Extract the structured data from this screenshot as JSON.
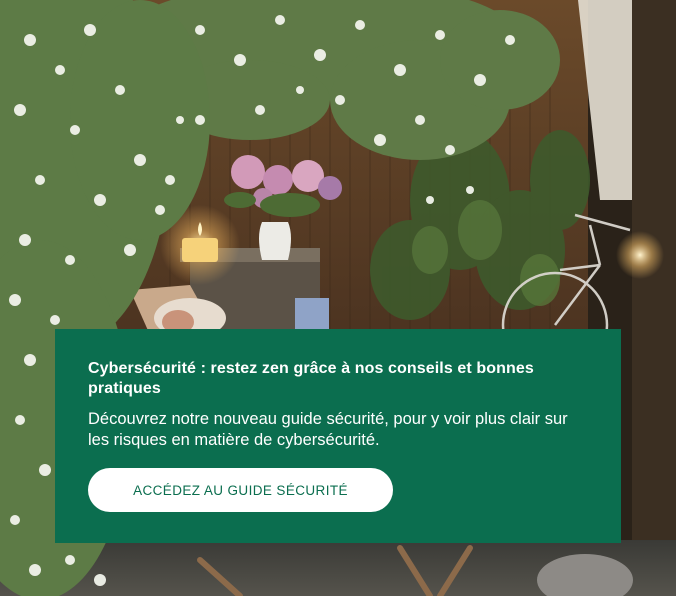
{
  "banner": {
    "title": "Cybersécurité : restez zen grâce à nos conseils et bonnes pratiques",
    "description": "Découvrez notre nouveau guide sécurité, pour y voir plus clair sur les risques en matière de cybersécurité.",
    "cta_label": "ACCÉDEZ AU GUIDE SÉCURITÉ"
  },
  "colors": {
    "card_background": "#0b6e4f",
    "button_background": "#ffffff",
    "button_text": "#0b6e4f"
  }
}
